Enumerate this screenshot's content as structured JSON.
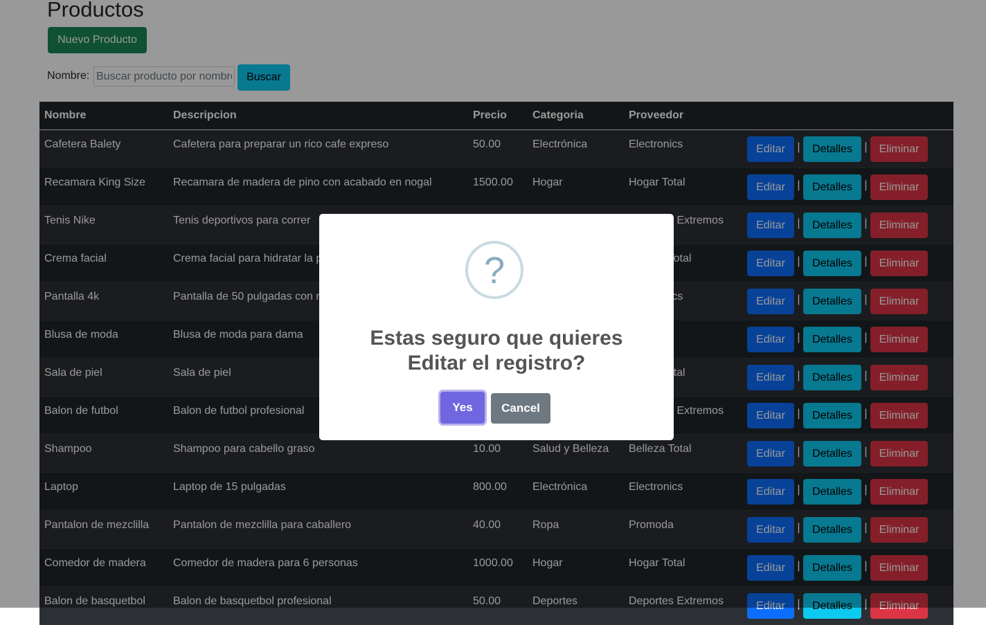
{
  "header": {
    "title": "Productos",
    "new_button": "Nuevo Producto"
  },
  "search": {
    "label": "Nombre:",
    "placeholder": "Buscar producto por nombre",
    "value": "",
    "button": "Buscar"
  },
  "table": {
    "columns": [
      "Nombre",
      "Descripcion",
      "Precio",
      "Categoria",
      "Proveedor",
      ""
    ],
    "actions": {
      "edit": "Editar",
      "details": "Detalles",
      "delete": "Eliminar",
      "separator": "|"
    },
    "rows": [
      {
        "nombre": "Cafetera Balety",
        "descripcion": "Cafetera para preparar un rico cafe expreso",
        "precio": "50.00",
        "categoria": "Electrónica",
        "proveedor": "Electronics"
      },
      {
        "nombre": "Recamara King Size",
        "descripcion": "Recamara de madera de pino con acabado en nogal",
        "precio": "1500.00",
        "categoria": "Hogar",
        "proveedor": "Hogar Total"
      },
      {
        "nombre": "Tenis Nike",
        "descripcion": "Tenis deportivos para correr",
        "precio": "",
        "categoria": "",
        "proveedor": "Deportes Extremos"
      },
      {
        "nombre": "Crema facial",
        "descripcion": "Crema facial para hidratar la piel",
        "precio": "",
        "categoria": "",
        "proveedor": "Belleza Total"
      },
      {
        "nombre": "Pantalla 4k",
        "descripcion": "Pantalla de 50 pulgadas con resolución 4k",
        "precio": "",
        "categoria": "",
        "proveedor": "Electronics"
      },
      {
        "nombre": "Blusa de moda",
        "descripcion": "Blusa de moda para dama",
        "precio": "",
        "categoria": "",
        "proveedor": ""
      },
      {
        "nombre": "Sala de piel",
        "descripcion": "Sala de piel",
        "precio": "",
        "categoria": "",
        "proveedor": "Hogar Total"
      },
      {
        "nombre": "Balon de futbol",
        "descripcion": "Balon de futbol profesional",
        "precio": "",
        "categoria": "",
        "proveedor": "Deportes Extremos"
      },
      {
        "nombre": "Shampoo",
        "descripcion": "Shampoo para cabello graso",
        "precio": "10.00",
        "categoria": "Salud y Belleza",
        "proveedor": "Belleza Total"
      },
      {
        "nombre": "Laptop",
        "descripcion": "Laptop de 15 pulgadas",
        "precio": "800.00",
        "categoria": "Electrónica",
        "proveedor": "Electronics"
      },
      {
        "nombre": "Pantalon de mezclilla",
        "descripcion": "Pantalon de mezclilla para caballero",
        "precio": "40.00",
        "categoria": "Ropa",
        "proveedor": "Promoda"
      },
      {
        "nombre": "Comedor de madera",
        "descripcion": "Comedor de madera para 6 personas",
        "precio": "1000.00",
        "categoria": "Hogar",
        "proveedor": "Hogar Total"
      },
      {
        "nombre": "Balon de basquetbol",
        "descripcion": "Balon de basquetbol profesional",
        "precio": "50.00",
        "categoria": "Deportes",
        "proveedor": "Deportes Extremos"
      }
    ]
  },
  "dialog": {
    "icon": "question-icon",
    "icon_glyph": "?",
    "title": "Estas seguro que quieres Editar el registro?",
    "confirm": "Yes",
    "cancel": "Cancel"
  },
  "colors": {
    "success": "#198754",
    "info": "#0dcaf0",
    "primary": "#0d6efd",
    "danger": "#dc3545",
    "table_dark": "#212529",
    "confirm": "#7066e0",
    "cancel": "#6e7881"
  }
}
